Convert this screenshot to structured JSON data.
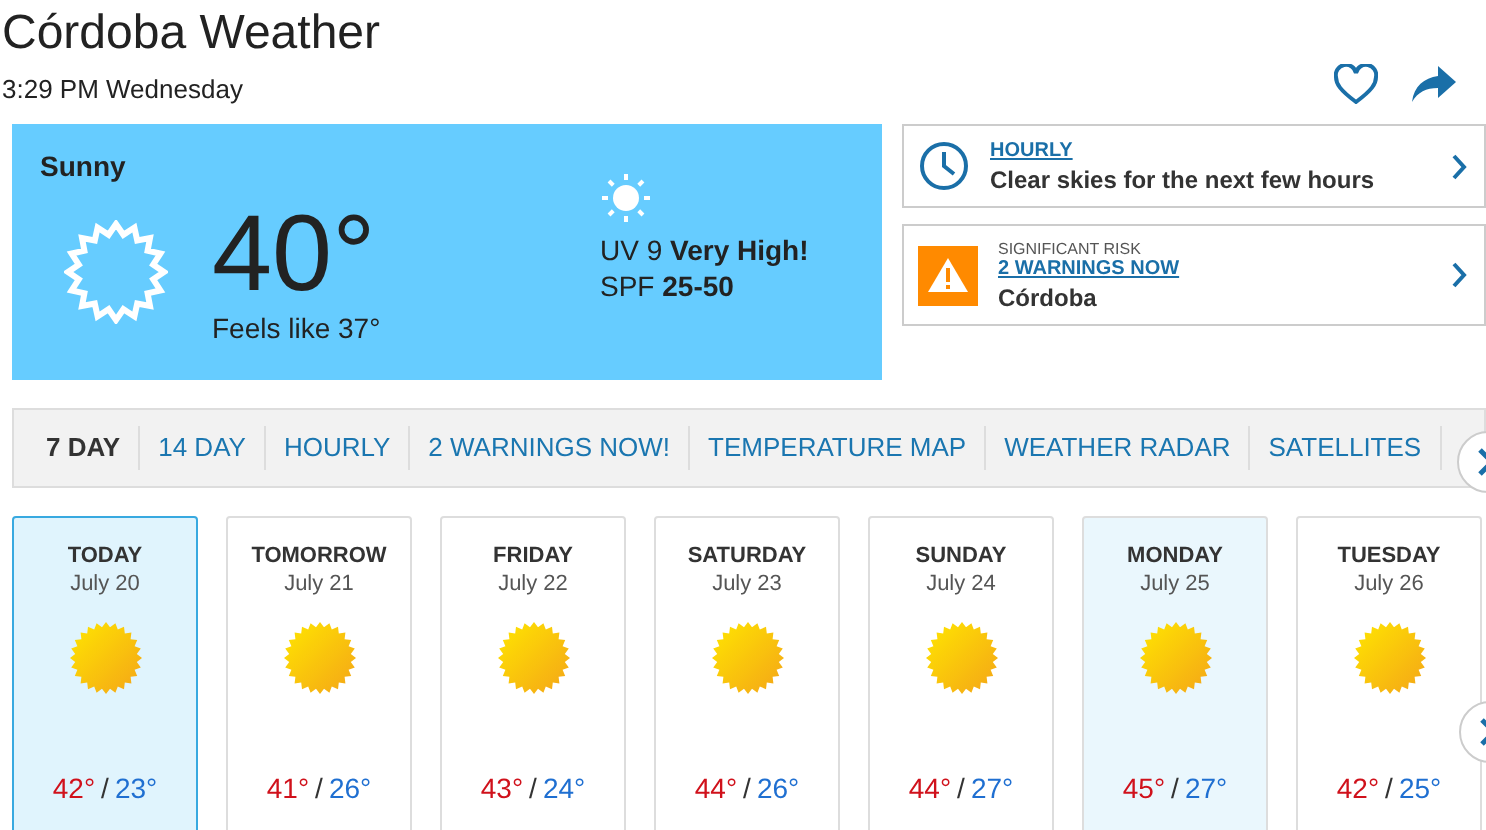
{
  "header": {
    "title": "Córdoba Weather",
    "time": "3:29 PM Wednesday"
  },
  "current": {
    "condition": "Sunny",
    "temperature": "40°",
    "feels_like": "Feels like 37°",
    "uv_label": "UV 9",
    "uv_level": "Very High!",
    "spf_label": "SPF",
    "spf_value": "25-50"
  },
  "alerts": [
    {
      "kind": "hourly",
      "link": "HOURLY",
      "text": "Clear skies for the next few hours"
    },
    {
      "kind": "warning",
      "label": "SIGNIFICANT RISK",
      "link": "2 WARNINGS NOW",
      "text": "Córdoba"
    }
  ],
  "tabs": [
    {
      "label": "7 DAY",
      "selected": true
    },
    {
      "label": "14 DAY",
      "selected": false
    },
    {
      "label": "HOURLY",
      "selected": false
    },
    {
      "label": "2 WARNINGS NOW!",
      "selected": false
    },
    {
      "label": "TEMPERATURE MAP",
      "selected": false
    },
    {
      "label": "WEATHER RADAR",
      "selected": false
    },
    {
      "label": "SATELLITES",
      "selected": false
    }
  ],
  "days": [
    {
      "day": "TODAY",
      "date": "July 20",
      "high": "42°",
      "low": "23°",
      "selected": true,
      "highlighted": true
    },
    {
      "day": "TOMORROW",
      "date": "July 21",
      "high": "41°",
      "low": "26°",
      "selected": false,
      "highlighted": false
    },
    {
      "day": "FRIDAY",
      "date": "July 22",
      "high": "43°",
      "low": "24°",
      "selected": false,
      "highlighted": false
    },
    {
      "day": "SATURDAY",
      "date": "July 23",
      "high": "44°",
      "low": "26°",
      "selected": false,
      "highlighted": false
    },
    {
      "day": "SUNDAY",
      "date": "July 24",
      "high": "44°",
      "low": "27°",
      "selected": false,
      "highlighted": false
    },
    {
      "day": "MONDAY",
      "date": "July 25",
      "high": "45°",
      "low": "27°",
      "selected": false,
      "highlighted": true
    },
    {
      "day": "TUESDAY",
      "date": "July 26",
      "high": "42°",
      "low": "25°",
      "selected": false,
      "highlighted": false
    }
  ],
  "temp_separator": "/"
}
